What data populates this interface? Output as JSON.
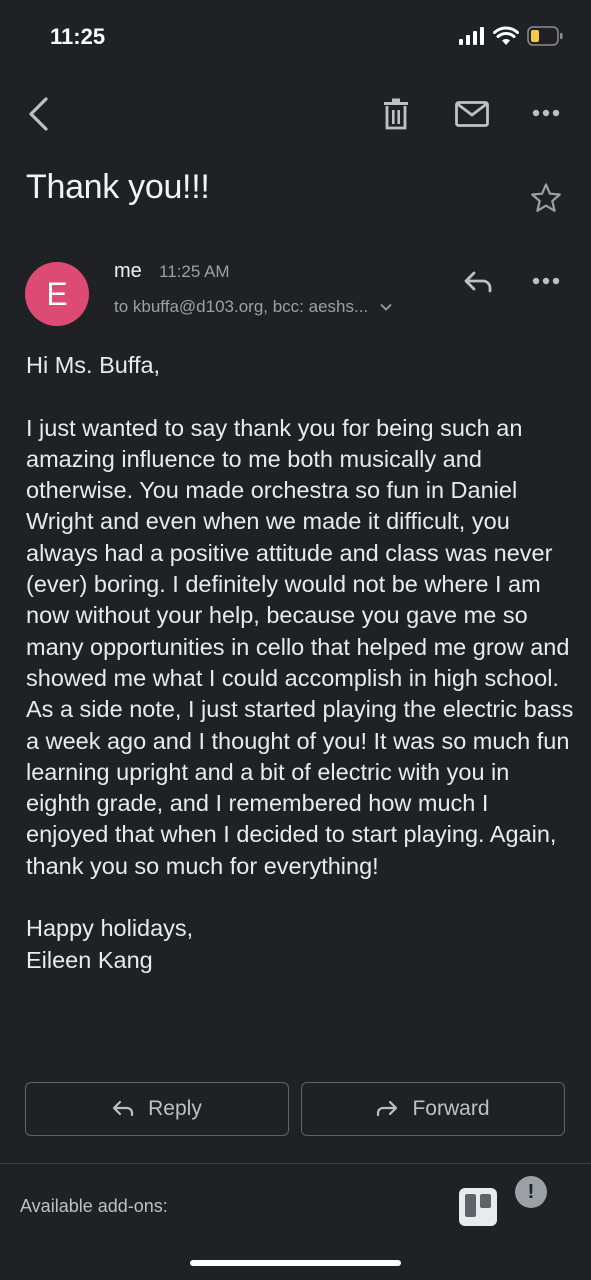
{
  "status_bar": {
    "time": "11:25"
  },
  "email": {
    "subject": "Thank you!!!",
    "sender": {
      "initial": "E",
      "name": "me",
      "time": "11:25 AM",
      "recipients": "to kbuffa@d103.org, bcc: aeshs..."
    },
    "body": {
      "greeting": "Hi Ms. Buffa,",
      "paragraph": "I just wanted to say thank you for being such an amazing influence to me both musically and otherwise. You made orchestra so fun in Daniel Wright and even when we made it difficult, you always had a positive attitude and class was never (ever) boring. I definitely would not be where I am now without your help, because you gave me so many opportunities in cello that helped me grow and showed me what I could accomplish in high school. As a side note, I just started playing the electric bass a week ago and I thought of you! It was so much fun learning upright and a bit of electric with you in eighth grade, and I remembered how much I enjoyed that when I decided to start playing. Again, thank you so much for everything!",
      "closing": "Happy holidays,",
      "signature": "Eileen Kang"
    }
  },
  "actions": {
    "reply_label": "Reply",
    "forward_label": "Forward"
  },
  "addons": {
    "label": "Available add-ons:",
    "alert_glyph": "!"
  },
  "colors": {
    "background": "#202124",
    "avatar": "#dd4b74",
    "battery": "#f2c94c"
  }
}
